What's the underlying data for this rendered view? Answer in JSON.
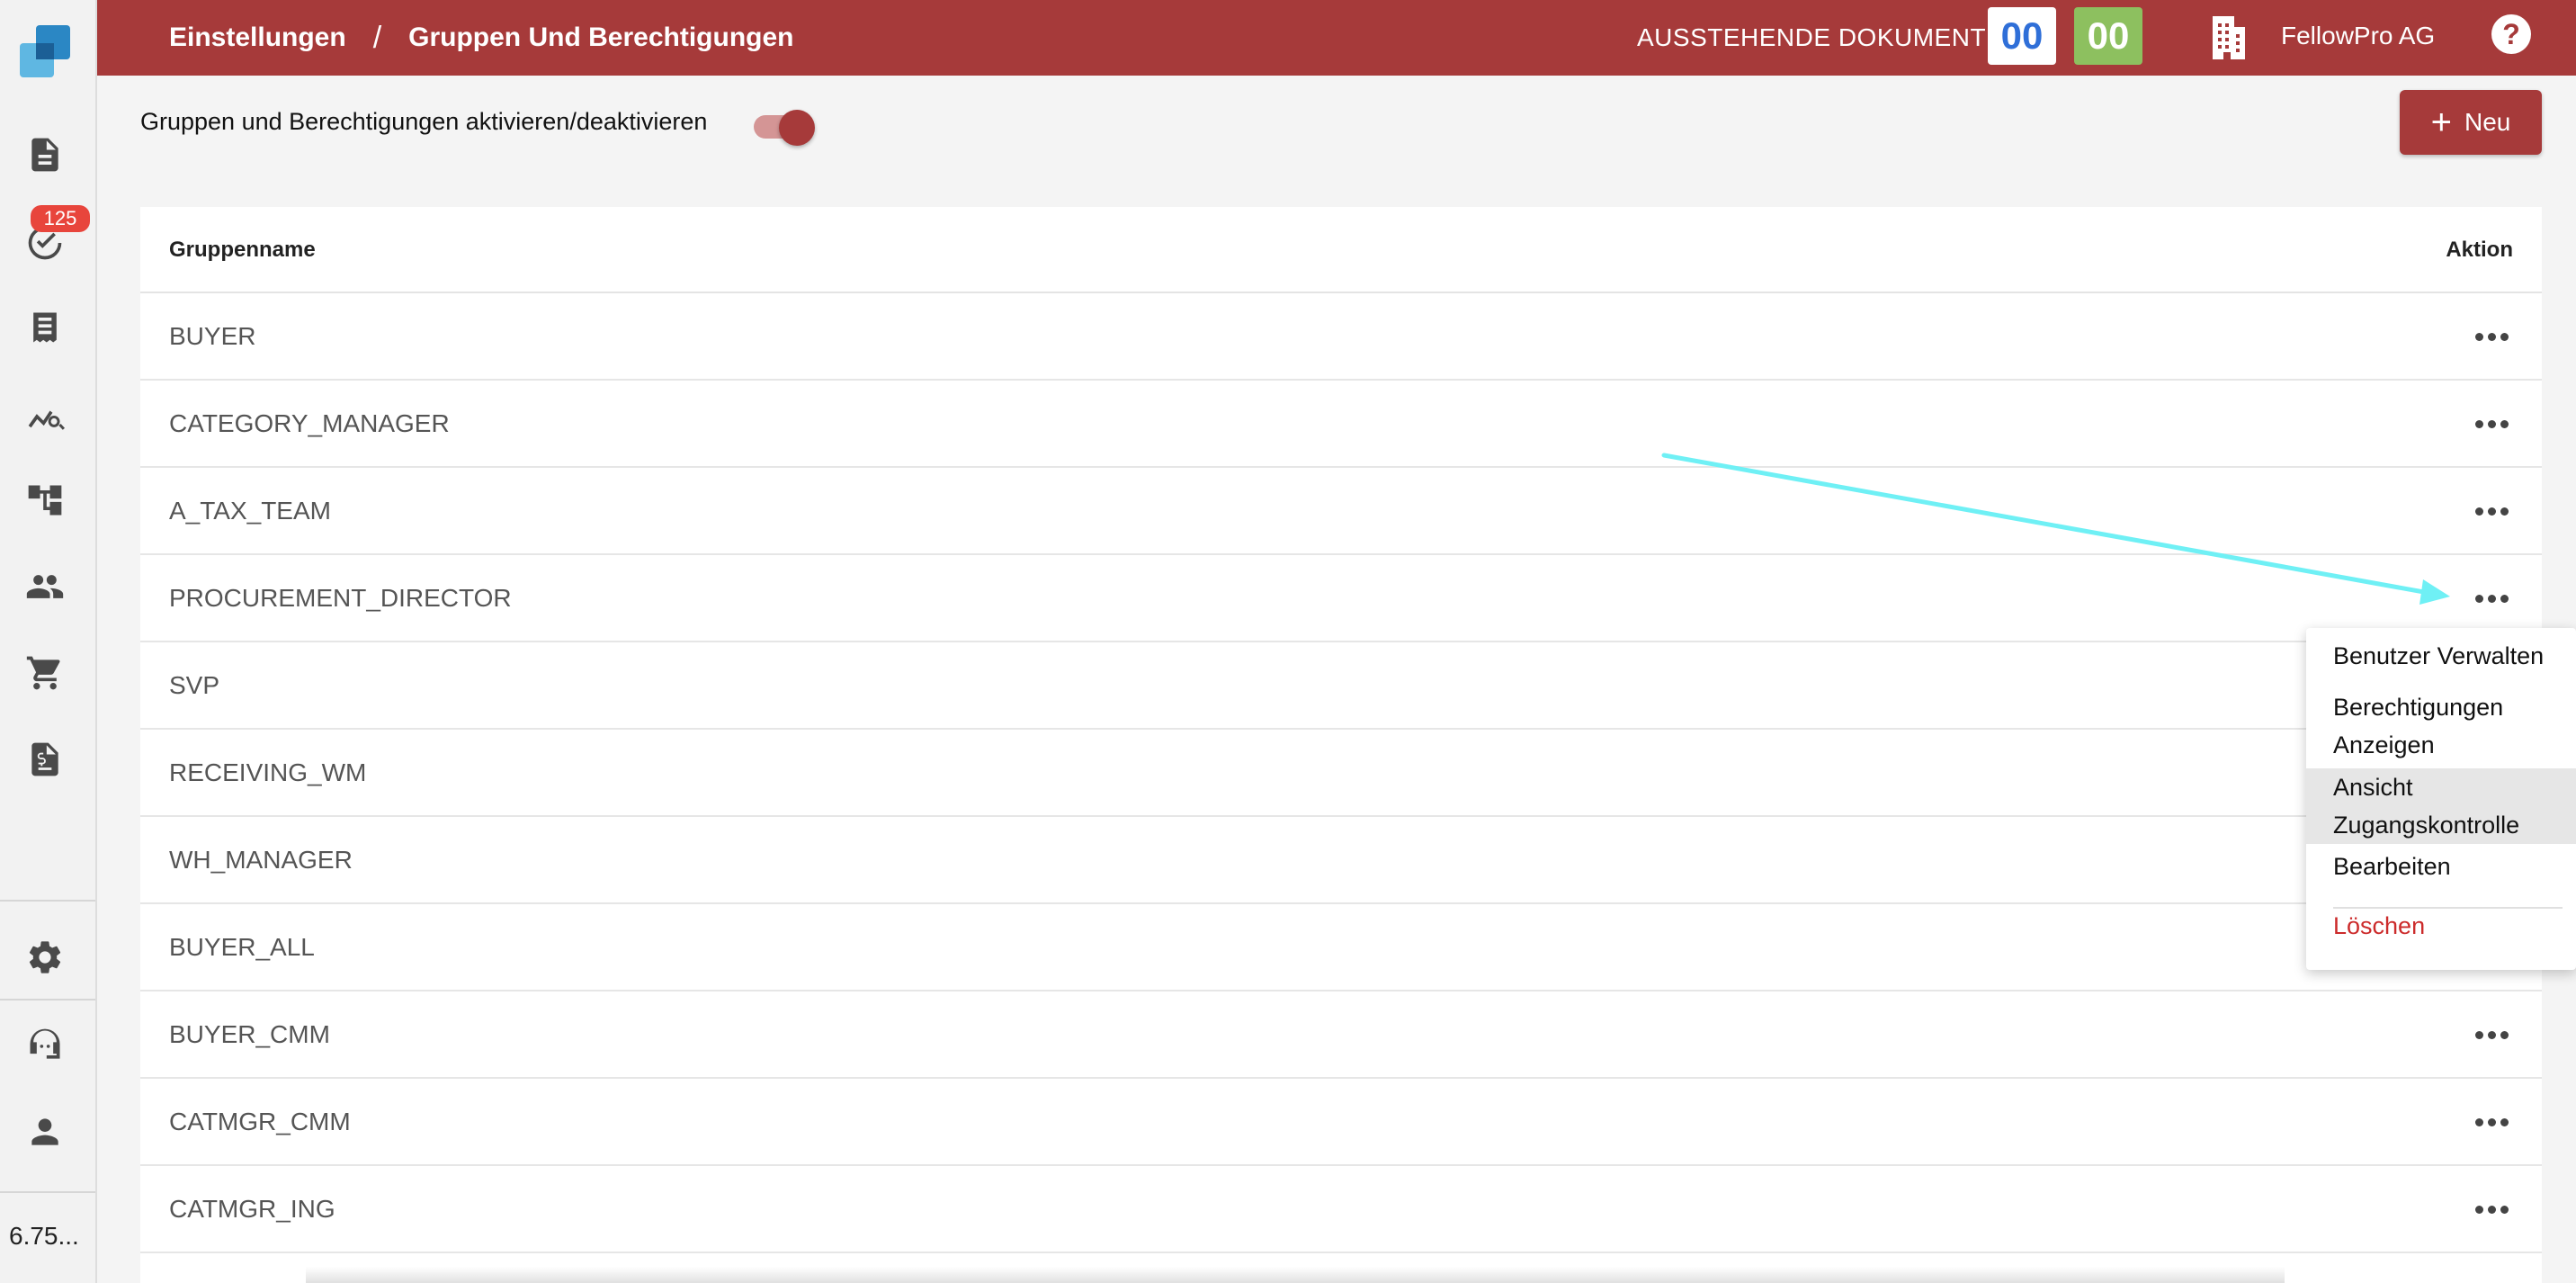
{
  "header": {
    "breadcrumb": [
      "Einstellungen",
      "Gruppen Und Berechtigungen"
    ],
    "separator": "/",
    "pending_label": "AUSSTEHENDE DOKUMENTE:",
    "pending_count_blue": "00",
    "pending_count_green": "00",
    "company": "FellowPro AG"
  },
  "sidebar": {
    "badge_count": "125",
    "version": "6.75..."
  },
  "toolbar": {
    "toggle_label": "Gruppen und Berechtigungen aktivieren/deaktivieren",
    "toggle_on": true,
    "new_button": "Neu",
    "new_icon": "+"
  },
  "table": {
    "columns": [
      "Gruppenname",
      "Aktion"
    ],
    "rows": [
      "BUYER",
      "CATEGORY_MANAGER",
      "A_TAX_TEAM",
      "PROCUREMENT_DIRECTOR",
      "SVP",
      "RECEIVING_WM",
      "WH_MANAGER",
      "BUYER_ALL",
      "BUYER_CMM",
      "CATMGR_CMM",
      "CATMGR_ING"
    ]
  },
  "menu": {
    "items": [
      "Benutzer Verwalten",
      "Berechtigungen Anzeigen",
      "Ansicht Zugangskontrolle",
      "Bearbeiten",
      "Löschen"
    ],
    "item_lines": [
      [
        "Benutzer Verwalten"
      ],
      [
        "Berechtigungen",
        "Anzeigen"
      ],
      [
        "Ansicht",
        "Zugangskontrolle"
      ],
      [
        "Bearbeiten"
      ],
      [
        "Löschen"
      ]
    ],
    "highlighted_item": "Ansicht Zugangskontrolle"
  },
  "colors": {
    "brand": "#a63a3a",
    "danger": "#cc2b2b",
    "badge": "#e8453c",
    "count_blue": "#2f6fd8",
    "count_green": "#8dc05f",
    "annotation_arrow": "#6ff0f5"
  },
  "icons": [
    "document-icon",
    "task-check-icon",
    "receipt-icon",
    "analytics-search-icon",
    "hierarchy-icon",
    "users-icon",
    "cart-icon",
    "invoice-icon",
    "gear-icon",
    "support-headset-icon",
    "person-icon",
    "building-icon",
    "help-icon",
    "more-dots-icon"
  ]
}
